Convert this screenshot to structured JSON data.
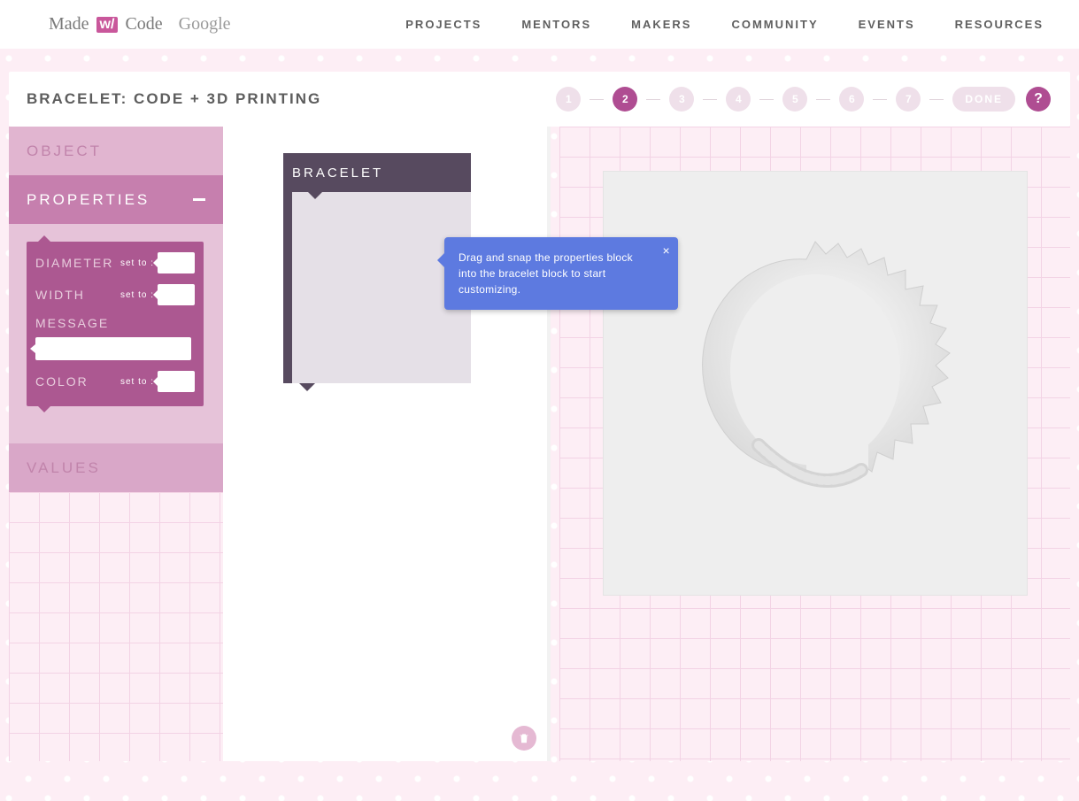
{
  "brand": {
    "made": "Made",
    "w": "w/",
    "code": "Code",
    "google": "Google"
  },
  "nav": {
    "projects": "PROJECTS",
    "mentors": "MENTORS",
    "makers": "MAKERS",
    "community": "COMMUNITY",
    "events": "EVENTS",
    "resources": "RESOURCES"
  },
  "project_title": "BRACELET: CODE + 3D PRINTING",
  "steps": [
    "1",
    "2",
    "3",
    "4",
    "5",
    "6",
    "7"
  ],
  "active_step_index": 1,
  "done_label": "DONE",
  "help_label": "?",
  "sidebar": {
    "object_header": "OBJECT",
    "properties_header": "PROPERTIES",
    "values_header": "VALUES"
  },
  "properties_block": {
    "diameter_label": "DIAMETER",
    "width_label": "WIDTH",
    "message_label": "MESSAGE",
    "color_label": "COLOR",
    "setto": "set to :"
  },
  "bracelet_block": {
    "title": "BRACELET"
  },
  "tooltip": {
    "text": "Drag and snap the properties block into the bracelet block to start customizing.",
    "close": "×"
  },
  "colors": {
    "accent": "#af4d92",
    "block": "#ac5891",
    "bracelet": "#574a5f",
    "tooltip": "#5d7ae0"
  }
}
